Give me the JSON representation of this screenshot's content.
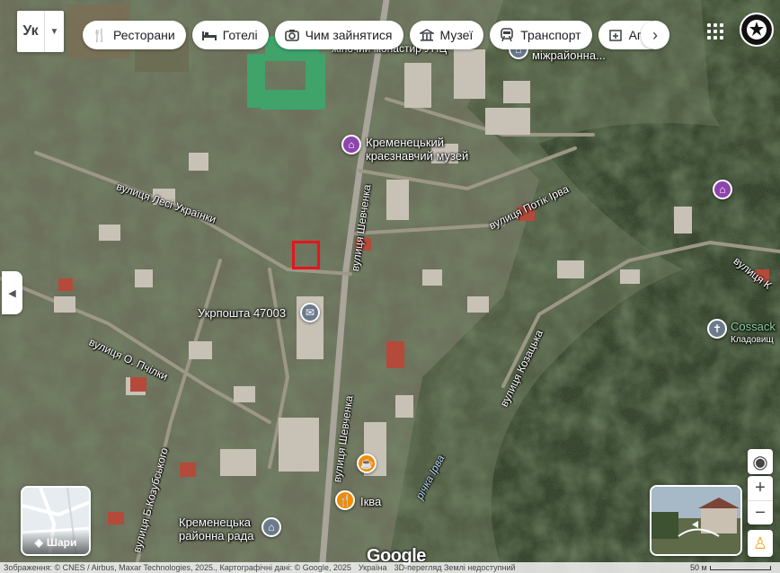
{
  "language_selector": {
    "value": "Ук"
  },
  "category_chips": [
    {
      "icon": "restaurant-icon",
      "label": "Ресторани"
    },
    {
      "icon": "hotel-icon",
      "label": "Готелі"
    },
    {
      "icon": "camera-icon",
      "label": "Чим зайнятися"
    },
    {
      "icon": "museum-icon",
      "label": "Музеї"
    },
    {
      "icon": "transit-icon",
      "label": "Транспорт"
    },
    {
      "icon": "pharmacy-icon",
      "label": "Апт"
    }
  ],
  "map": {
    "places": [
      {
        "id": "monastery",
        "label": "жіночий монастир УПЦ"
      },
      {
        "id": "mizhrayonna",
        "label": "міжрайонна..."
      },
      {
        "id": "museum",
        "label": "Кременецький\nкраєзнавчий музей"
      },
      {
        "id": "ukrposhta",
        "label": "Укрпошта 47003"
      },
      {
        "id": "cossack",
        "label": "Cossack"
      },
      {
        "id": "cemetery",
        "label": "Кладовищ"
      },
      {
        "id": "ikva_cafe",
        "label": "Іква"
      },
      {
        "id": "rayonna_rada",
        "label": "Кременецька\nрайонна рада"
      }
    ],
    "streets": [
      {
        "id": "lesi",
        "label": "вулиця Лесі Українки"
      },
      {
        "id": "shevchenka_top",
        "label": "вулиця Шевченка"
      },
      {
        "id": "shevchenka_bottom",
        "label": "вулиця Шевченка"
      },
      {
        "id": "potik",
        "label": "вулиця Потік Ірва"
      },
      {
        "id": "pchilky",
        "label": "вулиця О. Пчілки"
      },
      {
        "id": "kozubskoho",
        "label": "вулиця Б.Козубського"
      },
      {
        "id": "kozatska",
        "label": "вулиця Козацька"
      },
      {
        "id": "kozatska_right",
        "label": "вулиця К"
      },
      {
        "id": "richka",
        "label": "річка Ірва"
      }
    ]
  },
  "controls": {
    "layers_label": "Шари",
    "google_logo": "Google"
  },
  "footer": {
    "imagery": "Зображення: © CNES / Airbus, Maxar Technologies, 2025., Картографічні дані: © Google, 2025",
    "country": "Україна",
    "notice": "3D-перегляд Землі недоступний",
    "scale": "50 м"
  },
  "colors": {
    "marker_red": "#e8141b",
    "museum_purple": "#8e44ad",
    "food_orange": "#f28b00",
    "gov_gray": "#6b7b8c"
  }
}
